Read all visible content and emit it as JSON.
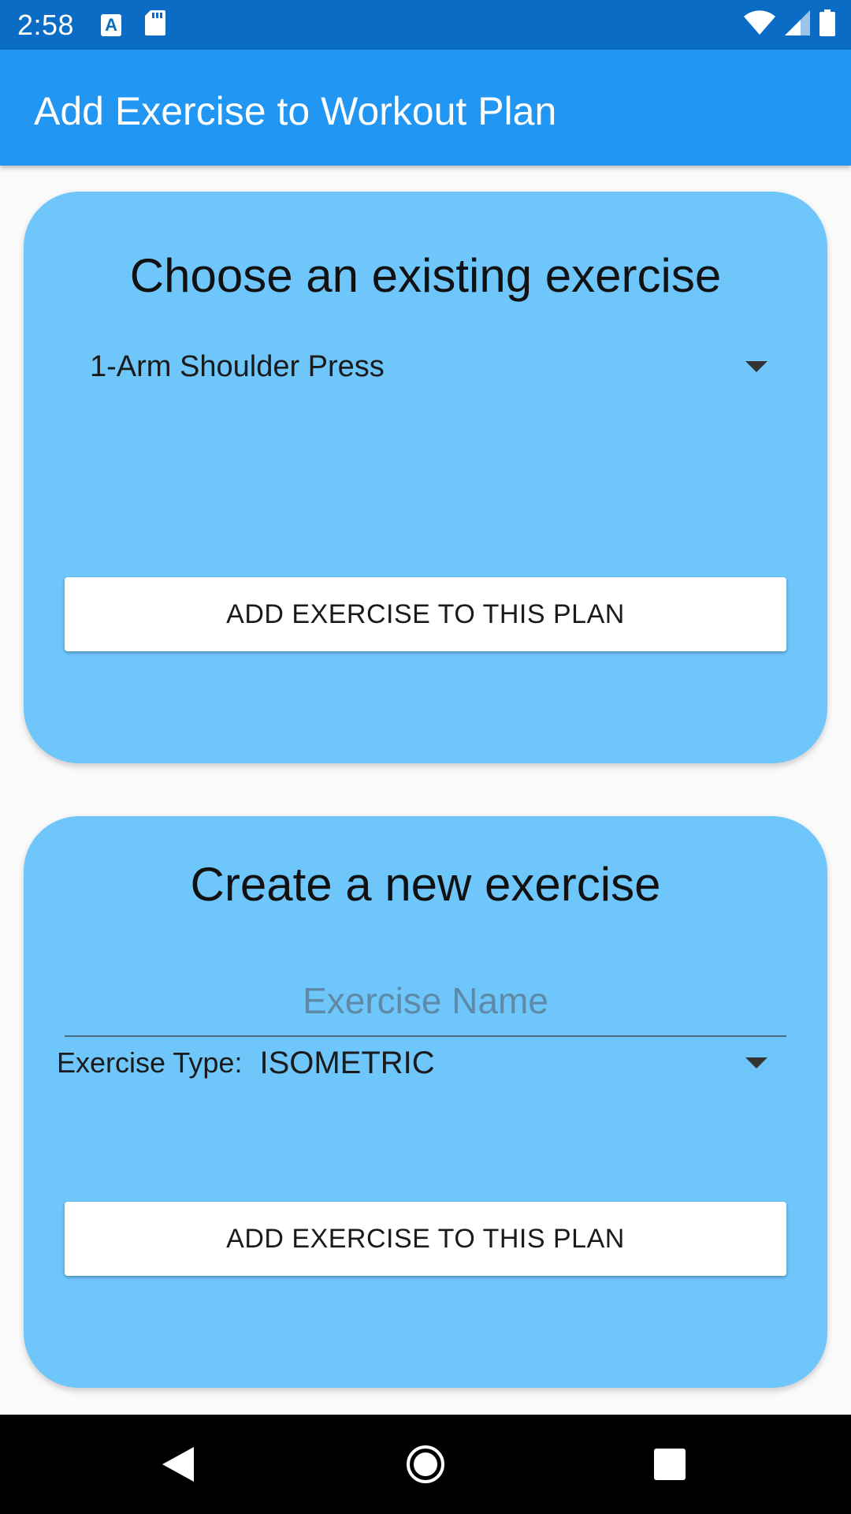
{
  "status_bar": {
    "time": "2:58",
    "icons": [
      "a-notification-icon",
      "sd-card-icon",
      "wifi-icon",
      "signal-icon",
      "battery-icon"
    ]
  },
  "app_bar": {
    "title": "Add Exercise to Workout Plan"
  },
  "existing_card": {
    "heading": "Choose an existing exercise",
    "selected_exercise": "1-Arm Shoulder Press",
    "button_label": "ADD EXERCISE TO THIS PLAN"
  },
  "new_card": {
    "heading": "Create a new exercise",
    "name_placeholder": "Exercise Name",
    "name_value": "",
    "type_label": "Exercise Type:",
    "type_value": "ISOMETRIC",
    "button_label": "ADD EXERCISE TO THIS PLAN"
  },
  "nav_bar": {
    "icons": [
      "back-icon",
      "home-icon",
      "recents-icon"
    ]
  },
  "colors": {
    "status_bar": "#0a6cc4",
    "app_bar": "#2196f3",
    "card": "#6ec6fb",
    "background": "#fafafa"
  }
}
